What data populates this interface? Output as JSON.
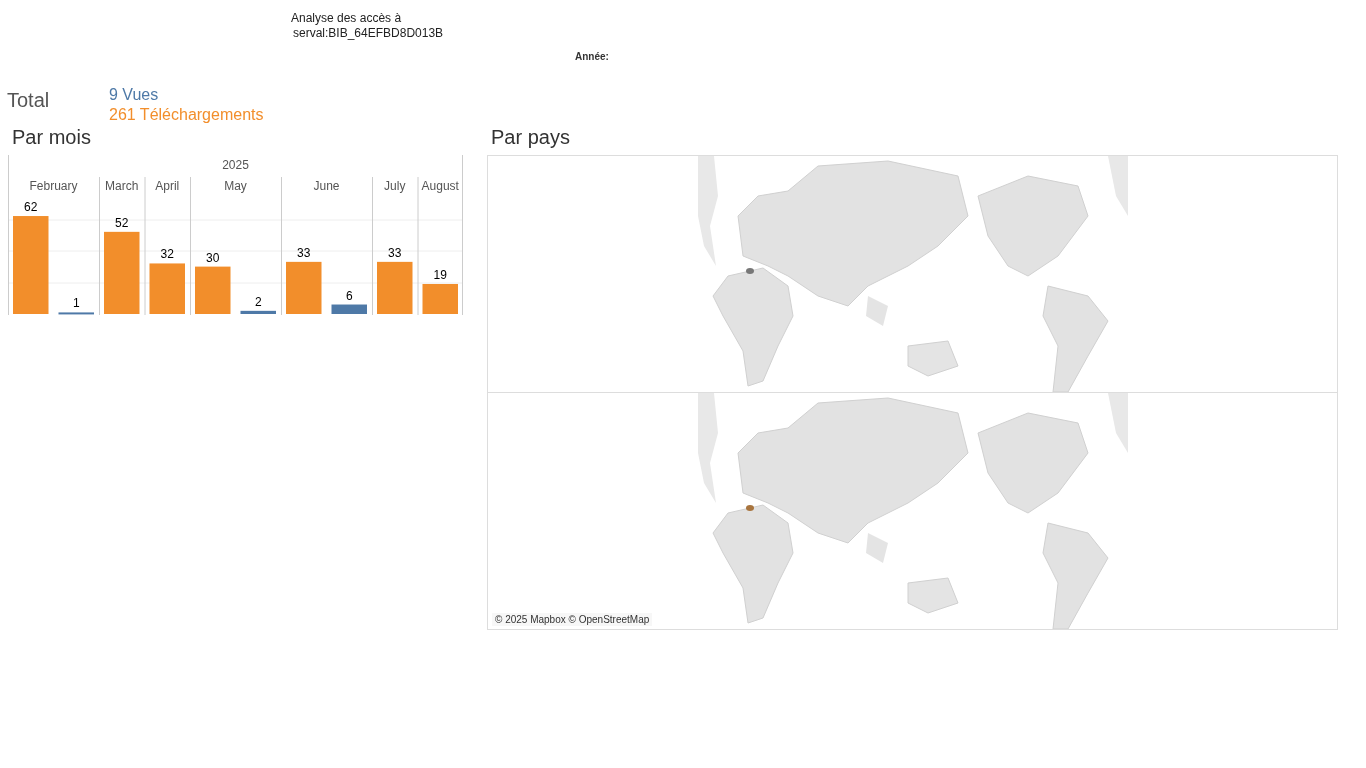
{
  "header": {
    "title_lines": [
      "Analyse des accès à",
      "serval:BIB_64EFBD8D013B"
    ],
    "year_filter_label": "Année:"
  },
  "totals": {
    "label": "Total",
    "items": [
      {
        "text": "9 Vues",
        "color": "#4e79a7"
      },
      {
        "text": "261 Téléchargements",
        "color": "#f28e2b"
      }
    ]
  },
  "by_month": {
    "title": "Par mois",
    "chart_data": {
      "type": "bar",
      "title": "2025",
      "categories": [
        "February",
        "March",
        "April",
        "May",
        "June",
        "July",
        "August"
      ],
      "series": [
        {
          "color": "#f28e2b",
          "values": [
            62,
            52,
            32,
            30,
            33,
            33,
            19
          ]
        },
        {
          "color": "#4e79a7",
          "values": [
            1,
            null,
            null,
            2,
            6,
            null,
            null
          ]
        }
      ],
      "data_labels": true
    }
  },
  "by_country": {
    "title": "Par pays",
    "attribution": "© 2025 Mapbox © OpenStreetMap"
  }
}
